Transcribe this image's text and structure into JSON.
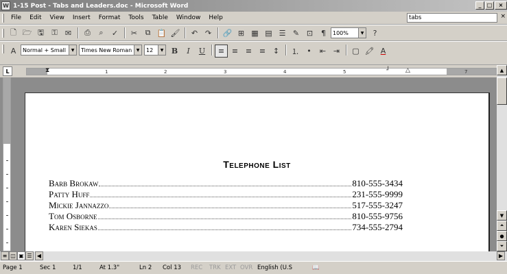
{
  "window": {
    "title": "1-15 Post - Tabs and Leaders.doc - Microsoft Word",
    "icon_letter": "W"
  },
  "menu": {
    "items": [
      {
        "label": "File",
        "key": "F"
      },
      {
        "label": "Edit",
        "key": "E"
      },
      {
        "label": "View",
        "key": "V"
      },
      {
        "label": "Insert",
        "key": "I"
      },
      {
        "label": "Format",
        "key": "o"
      },
      {
        "label": "Tools",
        "key": "T"
      },
      {
        "label": "Table",
        "key": "a"
      },
      {
        "label": "Window",
        "key": "W"
      },
      {
        "label": "Help",
        "key": "H"
      }
    ],
    "help_query": "tabs",
    "help_close": "×"
  },
  "standard_toolbar": {
    "zoom": "100%"
  },
  "formatting_toolbar": {
    "style": "Normal + Small",
    "font": "Times New Roman",
    "size": "12"
  },
  "ruler": {
    "ticks": [
      "1",
      "2",
      "3",
      "4",
      "5",
      "7"
    ]
  },
  "document": {
    "title": "Telephone List",
    "entries": [
      {
        "name": "Barb Brokaw",
        "phone": "810-555-3434"
      },
      {
        "name": "Patty Huff",
        "phone": "231-555-9999"
      },
      {
        "name": "Mickie Jannazzo",
        "phone": "517-555-3247"
      },
      {
        "name": "Tom Osborne",
        "phone": "810-555-9756"
      },
      {
        "name": "Karen Siekas",
        "phone": "734-555-2794"
      }
    ]
  },
  "status": {
    "page": "Page 1",
    "section": "Sec 1",
    "pages": "1/1",
    "at": "At 1.3\"",
    "line": "Ln 2",
    "col": "Col 13",
    "rec": "REC",
    "trk": "TRK",
    "ext": "EXT",
    "ovr": "OVR",
    "language": "English (U.S"
  }
}
